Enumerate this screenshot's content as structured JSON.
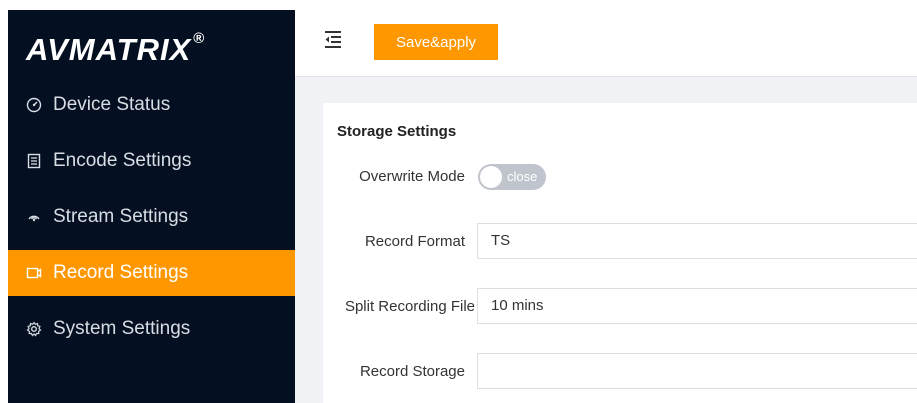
{
  "brand": {
    "name": "AVMATRIX",
    "reg": "®"
  },
  "sidebar": {
    "items": [
      {
        "label": "Device Status",
        "icon": "gauge-icon",
        "active": false
      },
      {
        "label": "Encode Settings",
        "icon": "document-icon",
        "active": false
      },
      {
        "label": "Stream Settings",
        "icon": "stream-icon",
        "active": false
      },
      {
        "label": "Record Settings",
        "icon": "record-icon",
        "active": true
      },
      {
        "label": "System Settings",
        "icon": "gear-icon",
        "active": false
      }
    ]
  },
  "toolbar": {
    "save_label": "Save&apply"
  },
  "storage": {
    "title": "Storage Settings",
    "overwrite_label": "Overwrite Mode",
    "overwrite_state": "close",
    "record_format_label": "Record Format",
    "record_format_value": "TS",
    "split_label": "Split Recording File",
    "split_value": "10 mins",
    "storage_label": "Record Storage",
    "storage_value": ""
  },
  "colors": {
    "accent": "#ff9800",
    "sidebar_bg": "#041021"
  }
}
